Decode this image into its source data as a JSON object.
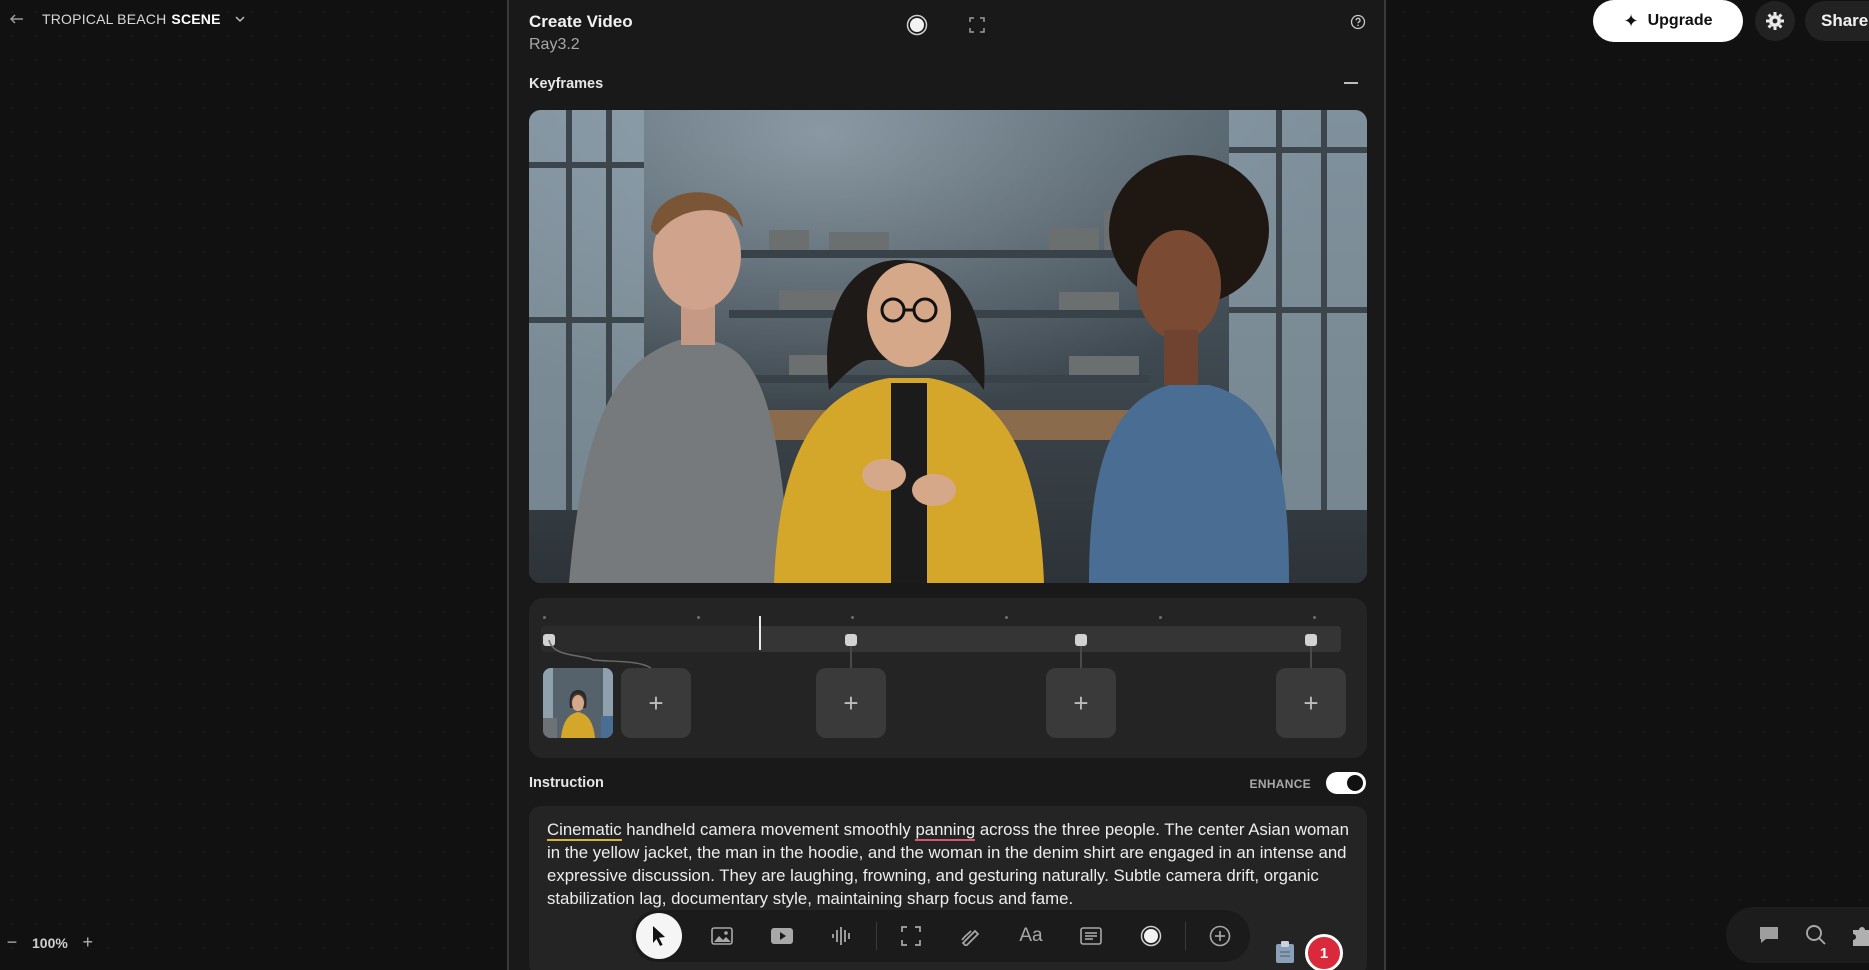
{
  "project": {
    "title_prefix": "TROPICAL BEACH",
    "title_bold": "SCENE"
  },
  "topbar": {
    "upgrade_label": "Upgrade",
    "share_label": "Share"
  },
  "zoom": {
    "value": "100%"
  },
  "panel": {
    "title": "Create Video",
    "model": "Ray3.2",
    "keyframes_label": "Keyframes",
    "instruction_label": "Instruction",
    "enhance_label": "ENHANCE",
    "enhance_on": true,
    "instruction": {
      "w1": "Cinematic",
      "w2": " handheld camera movement smoothly ",
      "w3": "panning",
      "w4": " across the three people. The center Asian woman in the yellow jacket, the man in the hoodie, and the woman in the denim shirt are engaged in an intense and expressive discussion. They are laughing, frowning, and gesturing naturally. Subtle camera drift, organic stabilization lag, documentary style, maintaining sharp focus and f",
      "w5": "ame."
    }
  },
  "timeline": {
    "slots": [
      "+",
      "+",
      "+",
      "+"
    ]
  },
  "notifications": {
    "count": "1"
  },
  "toolbar": {
    "text_tool_label": "Aa"
  },
  "icons": {
    "back": "arrow-left-icon",
    "dropdown": "chevron-down-icon",
    "settings": "gear-icon",
    "help": "help-circle-icon",
    "record": "record-icon",
    "fullscreen": "expand-icon"
  },
  "colors": {
    "background": "#111111",
    "panel": "#191919",
    "accent_underline_yellow": "#d8b43a",
    "accent_underline_red": "#d25a6b",
    "badge": "#d9293a"
  }
}
